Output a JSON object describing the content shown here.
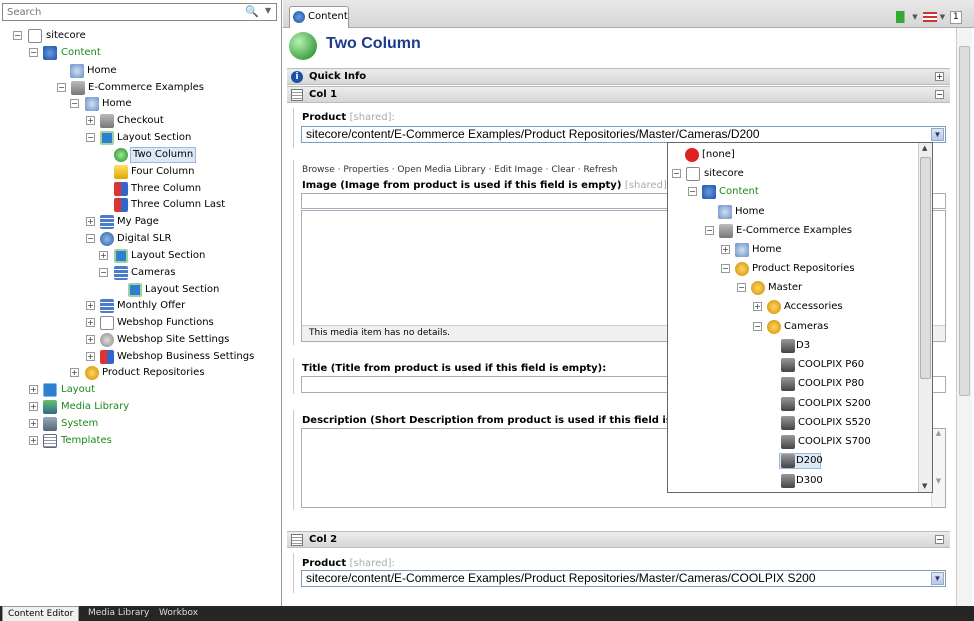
{
  "search": {
    "placeholder": "Search"
  },
  "tree": {
    "root": "sitecore",
    "content": "Content",
    "home": "Home",
    "ecommerce": "E-Commerce Examples",
    "ec_home": "Home",
    "checkout": "Checkout",
    "layout_section": "Layout Section",
    "two_column": "Two Column",
    "four_column": "Four Column",
    "three_column": "Three Column",
    "three_column_last": "Three Column Last",
    "my_page": "My Page",
    "digital_slr": "Digital SLR",
    "dslr_layout_section": "Layout Section",
    "cameras": "Cameras",
    "cameras_layout_section": "Layout Section",
    "monthly_offer": "Monthly Offer",
    "webshop_functions": "Webshop Functions",
    "webshop_site_settings": "Webshop Site Settings",
    "webshop_business_settings": "Webshop Business Settings",
    "product_repositories": "Product Repositories",
    "layout": "Layout",
    "media_library": "Media Library",
    "system": "System",
    "templates": "Templates"
  },
  "editor": {
    "tab_label": "Content",
    "item_title": "Two Column",
    "quick_info": "Quick Info",
    "col1": "Col 1",
    "col2": "Col 2",
    "product_label": "Product",
    "shared_tag": "[shared]:",
    "product_value_1": "sitecore/content/E-Commerce Examples/Product Repositories/Master/Cameras/D200",
    "product_value_2": "sitecore/content/E-Commerce Examples/Product Repositories/Master/Cameras/COOLPIX S200",
    "media_commands": "Browse  ·  Properties  ·  Open Media Library  ·  Edit Image  ·  Clear  ·  Refresh",
    "image_label": "Image (Image from product is used if this field is empty)",
    "media_note": "This media item has no details.",
    "title_label": "Title (Title from product is used if this field is empty):",
    "description_label": "Description (Short Description from product is used if this field is empty):",
    "version_badge": "1"
  },
  "popup": {
    "none": "[none]",
    "sitecore": "sitecore",
    "content": "Content",
    "home": "Home",
    "ecommerce": "E-Commerce Examples",
    "ec_home": "Home",
    "product_repositories": "Product Repositories",
    "master": "Master",
    "accessories": "Accessories",
    "cameras": "Cameras",
    "d3": "D3",
    "coolpix_p60": "COOLPIX P60",
    "coolpix_p80": "COOLPIX P80",
    "coolpix_s200": "COOLPIX S200",
    "coolpix_s520": "COOLPIX S520",
    "coolpix_s700": "COOLPIX S700",
    "d200": "D200",
    "d300": "D300"
  },
  "bottom_tabs": {
    "content_editor": "Content Editor",
    "media_library": "Media Library",
    "workbox": "Workbox"
  },
  "colors": {
    "accent": "#1c3b8b",
    "green_text": "#1a8a1a",
    "selection": "#dde8f7"
  }
}
